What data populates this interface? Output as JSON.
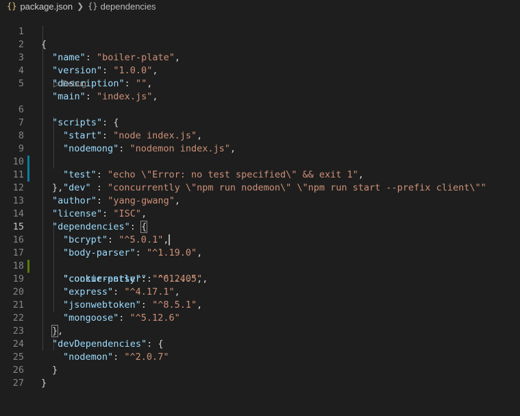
{
  "breadcrumb": {
    "file_icon": "{}",
    "file": "package.json",
    "symbol_icon": "{}",
    "symbol": "dependencies"
  },
  "codelens": "▷ Debug",
  "lines": {
    "1": [
      "{"
    ],
    "2": [
      "\"name\"",
      ": ",
      "\"boiler-plate\"",
      ","
    ],
    "3": [
      "\"version\"",
      ": ",
      "\"1.0.0\"",
      ","
    ],
    "4": [
      "\"description\"",
      ": ",
      "\"\"",
      ","
    ],
    "5": [
      "\"main\"",
      ": ",
      "\"index.js\"",
      ","
    ],
    "6": [
      "\"scripts\"",
      ": {"
    ],
    "7": [
      "\"start\"",
      ": ",
      "\"node index.js\"",
      ","
    ],
    "8": [
      "\"nodemong\"",
      ": ",
      "\"nodemon index.js\"",
      ","
    ],
    "9": [
      "\"test\"",
      ": ",
      "\"echo \\\"Error: no test specified\\\" && exit 1\"",
      ","
    ],
    "10": [
      "\"dev\"",
      " : ",
      "\"concurrently \\\"npm run nodemon\\\" \\\"npm run start --prefix client\\\"\""
    ],
    "11": [
      "},"
    ],
    "12": [
      "\"author\"",
      ": ",
      "\"yang-gwang\"",
      ","
    ],
    "13": [
      "\"license\"",
      ": ",
      "\"ISC\"",
      ","
    ],
    "14": [
      "\"dependencies\"",
      ": ",
      "{"
    ],
    "15": [
      "\"bcrypt\"",
      ": ",
      "\"^5.0.1\"",
      ","
    ],
    "16": [
      "\"body-parser\"",
      ": ",
      "\"^1.19.0\"",
      ","
    ],
    "17": [
      "\"concurrently\"",
      ": ",
      "\"^6.2.0\"",
      ","
    ],
    "18": [
      "\"cookie-parser\"",
      ": ",
      "\"^1.4.5\"",
      ","
    ],
    "19": [
      "\"express\"",
      ": ",
      "\"^4.17.1\"",
      ","
    ],
    "20": [
      "\"jsonwebtoken\"",
      ": ",
      "\"^8.5.1\"",
      ","
    ],
    "21": [
      "\"mongoose\"",
      ": ",
      "\"^5.12.6\""
    ],
    "22": [
      "}",
      ","
    ],
    "23": [
      "\"devDependencies\"",
      ": {"
    ],
    "24": [
      "\"nodemon\"",
      ": ",
      "\"^2.0.7\""
    ],
    "25": [
      "}"
    ],
    "26": [
      "}"
    ],
    "27": [
      ""
    ]
  },
  "line_numbers": [
    "1",
    "2",
    "3",
    "4",
    "5",
    "6",
    "7",
    "8",
    "9",
    "10",
    "11",
    "12",
    "13",
    "14",
    "15",
    "16",
    "17",
    "18",
    "19",
    "20",
    "21",
    "22",
    "23",
    "24",
    "25",
    "26",
    "27"
  ],
  "colors": {
    "background": "#1e1e1e",
    "key": "#9cdcfe",
    "string": "#ce9178",
    "punctuation": "#d4d4d4",
    "line_number": "#858585",
    "modified_bar": "#0c7d9d",
    "added_bar": "#587c0c"
  }
}
